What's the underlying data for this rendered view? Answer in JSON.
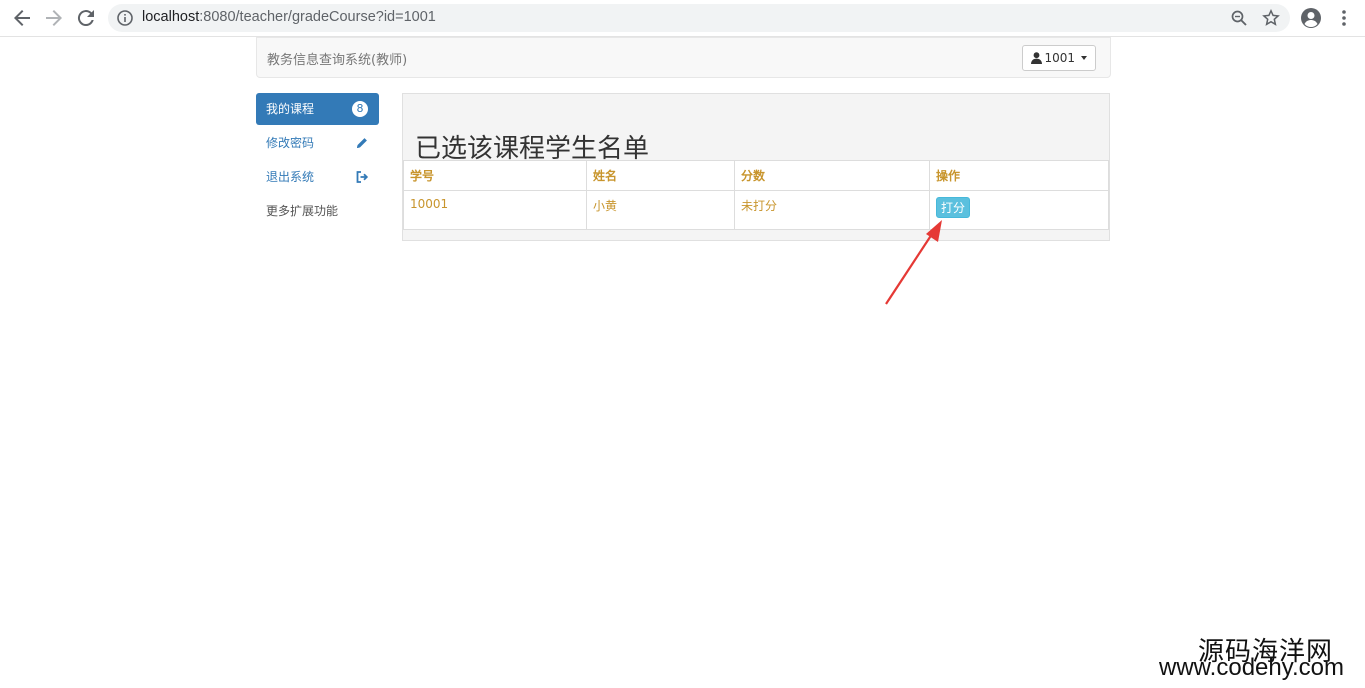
{
  "browser": {
    "url_host": "localhost",
    "url_rest": ":8080/teacher/gradeCourse?id=1001"
  },
  "navbar": {
    "brand": "教务信息查询系统(教师)",
    "user_label": "1001"
  },
  "sidebar": {
    "items": [
      {
        "label": "我的课程",
        "badge": "8"
      },
      {
        "label": "修改密码"
      },
      {
        "label": "退出系统"
      },
      {
        "label": "更多扩展功能"
      }
    ]
  },
  "panel": {
    "title": "已选该课程学生名单",
    "columns": [
      "学号",
      "姓名",
      "分数",
      "操作"
    ],
    "rows": [
      {
        "id": "10001",
        "name": "小黄",
        "score": "未打分",
        "action": "打分"
      }
    ]
  },
  "watermark": {
    "cn": "源码海洋网",
    "url": "www.codehy.com"
  },
  "colors": {
    "primary": "#337ab7",
    "info": "#5bc0de",
    "table_text": "#c8952d",
    "arrow": "#e53935"
  }
}
